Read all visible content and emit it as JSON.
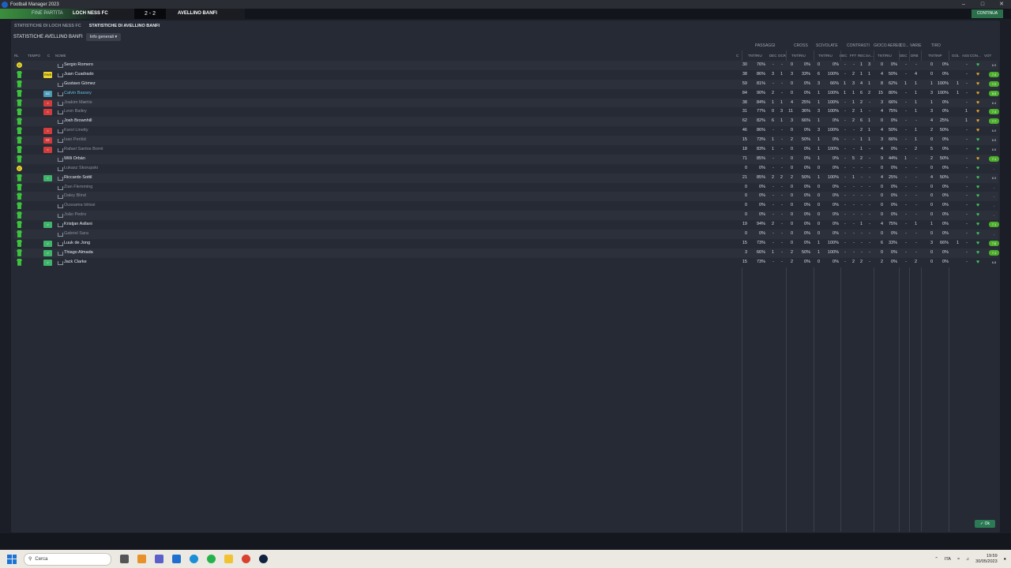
{
  "window": {
    "title": "Football Manager 2023"
  },
  "matchbar": {
    "status": "FINE PARTITA",
    "home": "LOCH NESS FC",
    "score": "2 - 2",
    "away": "AVELLINO BANFI",
    "right_label": "CONTINUA"
  },
  "tabs": [
    "STATISTICHE DI LOCH NESS FC",
    "STATISTICHE DI AVELLINO BANFI"
  ],
  "subhead": {
    "title": "STATISTICHE AVELLINO BANFI",
    "view": "Info generali"
  },
  "groups": [
    "PASSAGGI",
    "CROSS",
    "SCIVOLATE",
    "CONTRASTI",
    "GIOCO AEREO",
    "CO...",
    "VARIE",
    "TIRO"
  ],
  "columns": {
    "rl": "RL",
    "tempo": "TEMPO",
    "c": "C",
    "nome": "NOME",
    "c2": "C",
    "pass": "TNT/RIU",
    "dec": "DEC",
    "occ": "OCR",
    "cross": "TNT/RIU",
    "scivolate": "TNT/RIU",
    "contr_dec": "DEC",
    "fft": "FFT",
    "rec": "REC",
    "sa": "SA...",
    "aereo": "TNT/RIU",
    "co_dec": "DEC",
    "dri": "DRB",
    "tiro": "TNT/INP",
    "gol": "GOL",
    "ass": "ASS",
    "con": "CON...",
    "vot": "VOT"
  },
  "players": [
    {
      "name": "Sergio Romero",
      "role": "",
      "role_color": "",
      "captain": true,
      "pass_t": "30",
      "pass_p": "76%",
      "dec": "-",
      "occ": "-",
      "cr_t": "0",
      "cr_p": "0%",
      "sc_t": "0",
      "sc_p": "0%",
      "cd": "-",
      "fft": "-",
      "rec": "1",
      "sa": "3",
      "ae_t": "0",
      "ae_p": "0%",
      "co": "-",
      "drb": "-",
      "ti_t": "0",
      "ti_p": "0%",
      "gol": "",
      "ass": "-",
      "heart": "g",
      "vot": "6.9",
      "vot_good": false,
      "dim": false
    },
    {
      "name": "Juan Cuadrado",
      "role": "RWB",
      "role_color": "y",
      "captain": false,
      "pass_t": "38",
      "pass_p": "86%",
      "dec": "3",
      "occ": "1",
      "cr_t": "3",
      "cr_p": "33%",
      "sc_t": "6",
      "sc_p": "100%",
      "cd": "-",
      "fft": "2",
      "rec": "1",
      "sa": "1",
      "ae_t": "4",
      "ae_p": "50%",
      "co": "-",
      "drb": "4",
      "ti_t": "0",
      "ti_p": "0%",
      "gol": "",
      "ass": "-",
      "heart": "o",
      "vot": "7.4",
      "vot_good": true,
      "dim": false
    },
    {
      "name": "Gustavo Gómez",
      "role": "",
      "role_color": "",
      "captain": false,
      "pass_t": "59",
      "pass_p": "81%",
      "dec": "-",
      "occ": "-",
      "cr_t": "0",
      "cr_p": "0%",
      "sc_t": "3",
      "sc_p": "66%",
      "cd": "1",
      "fft": "3",
      "rec": "4",
      "sa": "1",
      "ae_t": "8",
      "ae_p": "62%",
      "co": "1",
      "drb": "1",
      "ti_t": "1",
      "ti_p": "100%",
      "gol": "1",
      "ass": "-",
      "heart": "o",
      "vot": "7.2",
      "vot_good": true,
      "dim": false
    },
    {
      "name": "Calvin Bassey",
      "role": "DC",
      "role_color": "b",
      "captain": false,
      "pass_t": "84",
      "pass_p": "90%",
      "dec": "2",
      "occ": "-",
      "cr_t": "0",
      "cr_p": "0%",
      "sc_t": "1",
      "sc_p": "100%",
      "cd": "1",
      "fft": "1",
      "rec": "6",
      "sa": "2",
      "ae_t": "15",
      "ae_p": "80%",
      "co": "-",
      "drb": "1",
      "ti_t": "3",
      "ti_p": "100%",
      "gol": "1",
      "ass": "-",
      "heart": "o",
      "vot": "8.5",
      "vot_good": true,
      "dim": false,
      "highlight": true
    },
    {
      "name": "Joakim Mæhle",
      "role": "<",
      "role_color": "r",
      "captain": false,
      "pass_t": "38",
      "pass_p": "84%",
      "dec": "1",
      "occ": "1",
      "cr_t": "4",
      "cr_p": "25%",
      "sc_t": "1",
      "sc_p": "100%",
      "cd": "-",
      "fft": "1",
      "rec": "2",
      "sa": "-",
      "ae_t": "3",
      "ae_p": "66%",
      "co": "-",
      "drb": "1",
      "ti_t": "1",
      "ti_p": "0%",
      "gol": "",
      "ass": "-",
      "heart": "o",
      "vot": "6.4",
      "vot_good": false,
      "dim": true
    },
    {
      "name": "Leon Bailey",
      "role": "<",
      "role_color": "r",
      "captain": false,
      "pass_t": "31",
      "pass_p": "77%",
      "dec": "0",
      "occ": "3",
      "cr_t": "11",
      "cr_p": "36%",
      "sc_t": "3",
      "sc_p": "100%",
      "cd": "-",
      "fft": "2",
      "rec": "1",
      "sa": "-",
      "ae_t": "4",
      "ae_p": "75%",
      "co": "-",
      "drb": "1",
      "ti_t": "3",
      "ti_p": "0%",
      "gol": "",
      "ass": "1",
      "heart": "o",
      "vot": "7.4",
      "vot_good": true,
      "dim": true
    },
    {
      "name": "Josh Brownhill",
      "role": "",
      "role_color": "",
      "captain": false,
      "pass_t": "62",
      "pass_p": "82%",
      "dec": "6",
      "occ": "1",
      "cr_t": "3",
      "cr_p": "66%",
      "sc_t": "1",
      "sc_p": "0%",
      "cd": "-",
      "fft": "2",
      "rec": "6",
      "sa": "1",
      "ae_t": "0",
      "ae_p": "0%",
      "co": "-",
      "drb": "-",
      "ti_t": "4",
      "ti_p": "25%",
      "gol": "",
      "ass": "1",
      "heart": "o",
      "vot": "7.7",
      "vot_good": true,
      "dim": false
    },
    {
      "name": "Karol Linetty",
      "role": "<",
      "role_color": "r",
      "captain": false,
      "pass_t": "46",
      "pass_p": "86%",
      "dec": "-",
      "occ": "-",
      "cr_t": "0",
      "cr_p": "0%",
      "sc_t": "3",
      "sc_p": "100%",
      "cd": "-",
      "fft": "-",
      "rec": "2",
      "sa": "1",
      "ae_t": "4",
      "ae_p": "50%",
      "co": "-",
      "drb": "1",
      "ti_t": "2",
      "ti_p": "50%",
      "gol": "",
      "ass": "-",
      "heart": "o",
      "vot": "6.9",
      "vot_good": false,
      "dim": true
    },
    {
      "name": "Ivan Perišić",
      "role": "ST",
      "role_color": "r",
      "captain": false,
      "pass_t": "15",
      "pass_p": "73%",
      "dec": "1",
      "occ": "-",
      "cr_t": "2",
      "cr_p": "50%",
      "sc_t": "1",
      "sc_p": "0%",
      "cd": "-",
      "fft": "-",
      "rec": "1",
      "sa": "1",
      "ae_t": "3",
      "ae_p": "66%",
      "co": "-",
      "drb": "1",
      "ti_t": "0",
      "ti_p": "0%",
      "gol": "",
      "ass": "-",
      "heart": "r",
      "vot": "6.5",
      "vot_good": false,
      "dim": true
    },
    {
      "name": "Rafael Santos Borré",
      "role": "<",
      "role_color": "r",
      "captain": false,
      "pass_t": "18",
      "pass_p": "83%",
      "dec": "1",
      "occ": "-",
      "cr_t": "0",
      "cr_p": "0%",
      "sc_t": "1",
      "sc_p": "100%",
      "cd": "-",
      "fft": "-",
      "rec": "1",
      "sa": "-",
      "ae_t": "4",
      "ae_p": "0%",
      "co": "-",
      "drb": "2",
      "ti_t": "5",
      "ti_p": "0%",
      "gol": "",
      "ass": "-",
      "heart": "g",
      "vot": "6.5",
      "vot_good": false,
      "dim": true
    },
    {
      "name": "Willi Orbán",
      "role": "",
      "role_color": "",
      "captain": false,
      "pass_t": "71",
      "pass_p": "85%",
      "dec": "-",
      "occ": "-",
      "cr_t": "0",
      "cr_p": "0%",
      "sc_t": "1",
      "sc_p": "0%",
      "cd": "-",
      "fft": "5",
      "rec": "2",
      "sa": "-",
      "ae_t": "9",
      "ae_p": "44%",
      "co": "1",
      "drb": "-",
      "ti_t": "2",
      "ti_p": "50%",
      "gol": "",
      "ass": "-",
      "heart": "o",
      "vot": "7.1",
      "vot_good": true,
      "dim": false
    },
    {
      "name": "Łukasz Skorupski",
      "role": "",
      "role_color": "",
      "captain": true,
      "pass_t": "0",
      "pass_p": "0%",
      "dec": "-",
      "occ": "-",
      "cr_t": "0",
      "cr_p": "0%",
      "sc_t": "0",
      "sc_p": "0%",
      "cd": "-",
      "fft": "-",
      "rec": "-",
      "sa": "-",
      "ae_t": "0",
      "ae_p": "0%",
      "co": "-",
      "drb": "-",
      "ti_t": "0",
      "ti_p": "0%",
      "gol": "",
      "ass": "-",
      "heart": "g",
      "vot": "-",
      "vot_good": false,
      "dim": true
    },
    {
      "name": "Riccardo Sottil",
      "role": ">",
      "role_color": "g",
      "captain": false,
      "pass_t": "21",
      "pass_p": "85%",
      "dec": "2",
      "occ": "2",
      "cr_t": "2",
      "cr_p": "50%",
      "sc_t": "1",
      "sc_p": "100%",
      "cd": "-",
      "fft": "1",
      "rec": "-",
      "sa": "-",
      "ae_t": "4",
      "ae_p": "25%",
      "co": "-",
      "drb": "-",
      "ti_t": "4",
      "ti_p": "50%",
      "gol": "",
      "ass": "-",
      "heart": "g",
      "vot": "6.9",
      "vot_good": false,
      "dim": false
    },
    {
      "name": "Zian Flemming",
      "role": "",
      "role_color": "",
      "captain": false,
      "pass_t": "0",
      "pass_p": "0%",
      "dec": "-",
      "occ": "-",
      "cr_t": "0",
      "cr_p": "0%",
      "sc_t": "0",
      "sc_p": "0%",
      "cd": "-",
      "fft": "-",
      "rec": "-",
      "sa": "-",
      "ae_t": "0",
      "ae_p": "0%",
      "co": "-",
      "drb": "-",
      "ti_t": "0",
      "ti_p": "0%",
      "gol": "",
      "ass": "-",
      "heart": "g",
      "vot": "-",
      "vot_good": false,
      "dim": true
    },
    {
      "name": "Daley Blind",
      "role": "",
      "role_color": "",
      "captain": false,
      "pass_t": "0",
      "pass_p": "0%",
      "dec": "-",
      "occ": "-",
      "cr_t": "0",
      "cr_p": "0%",
      "sc_t": "0",
      "sc_p": "0%",
      "cd": "-",
      "fft": "-",
      "rec": "-",
      "sa": "-",
      "ae_t": "0",
      "ae_p": "0%",
      "co": "-",
      "drb": "-",
      "ti_t": "0",
      "ti_p": "0%",
      "gol": "",
      "ass": "-",
      "heart": "g",
      "vot": "-",
      "vot_good": false,
      "dim": true
    },
    {
      "name": "Oussama Idrissi",
      "role": "",
      "role_color": "",
      "captain": false,
      "pass_t": "0",
      "pass_p": "0%",
      "dec": "-",
      "occ": "-",
      "cr_t": "0",
      "cr_p": "0%",
      "sc_t": "0",
      "sc_p": "0%",
      "cd": "-",
      "fft": "-",
      "rec": "-",
      "sa": "-",
      "ae_t": "0",
      "ae_p": "0%",
      "co": "-",
      "drb": "-",
      "ti_t": "0",
      "ti_p": "0%",
      "gol": "",
      "ass": "-",
      "heart": "g",
      "vot": "-",
      "vot_good": false,
      "dim": true
    },
    {
      "name": "João Pedro",
      "role": "",
      "role_color": "",
      "captain": false,
      "pass_t": "0",
      "pass_p": "0%",
      "dec": "-",
      "occ": "-",
      "cr_t": "0",
      "cr_p": "0%",
      "sc_t": "0",
      "sc_p": "0%",
      "cd": "-",
      "fft": "-",
      "rec": "-",
      "sa": "-",
      "ae_t": "0",
      "ae_p": "0%",
      "co": "-",
      "drb": "-",
      "ti_t": "0",
      "ti_p": "0%",
      "gol": "",
      "ass": "-",
      "heart": "g",
      "vot": "-",
      "vot_good": false,
      "dim": true
    },
    {
      "name": "Kristjan Asllani",
      "role": ">",
      "role_color": "g",
      "captain": false,
      "pass_t": "19",
      "pass_p": "94%",
      "dec": "2",
      "occ": "-",
      "cr_t": "0",
      "cr_p": "0%",
      "sc_t": "0",
      "sc_p": "0%",
      "cd": "-",
      "fft": "-",
      "rec": "1",
      "sa": "-",
      "ae_t": "4",
      "ae_p": "75%",
      "co": "-",
      "drb": "1",
      "ti_t": "1",
      "ti_p": "0%",
      "gol": "",
      "ass": "-",
      "heart": "g",
      "vot": "7.1",
      "vot_good": true,
      "dim": false
    },
    {
      "name": "Gabriel Sara",
      "role": "",
      "role_color": "",
      "captain": false,
      "pass_t": "0",
      "pass_p": "0%",
      "dec": "-",
      "occ": "-",
      "cr_t": "0",
      "cr_p": "0%",
      "sc_t": "0",
      "sc_p": "0%",
      "cd": "-",
      "fft": "-",
      "rec": "-",
      "sa": "-",
      "ae_t": "0",
      "ae_p": "0%",
      "co": "-",
      "drb": "-",
      "ti_t": "0",
      "ti_p": "0%",
      "gol": "",
      "ass": "-",
      "heart": "g",
      "vot": "-",
      "vot_good": false,
      "dim": true
    },
    {
      "name": "Luuk de Jong",
      "role": ">",
      "role_color": "g",
      "captain": false,
      "pass_t": "15",
      "pass_p": "73%",
      "dec": "-",
      "occ": "-",
      "cr_t": "0",
      "cr_p": "0%",
      "sc_t": "1",
      "sc_p": "100%",
      "cd": "-",
      "fft": "-",
      "rec": "-",
      "sa": "-",
      "ae_t": "6",
      "ae_p": "33%",
      "co": "-",
      "drb": "-",
      "ti_t": "3",
      "ti_p": "66%",
      "gol": "1",
      "ass": "-",
      "heart": "g",
      "vot": "7.6",
      "vot_good": true,
      "dim": false
    },
    {
      "name": "Thiago Almada",
      "role": ">",
      "role_color": "g",
      "captain": false,
      "pass_t": "3",
      "pass_p": "66%",
      "dec": "1",
      "occ": "-",
      "cr_t": "2",
      "cr_p": "50%",
      "sc_t": "1",
      "sc_p": "100%",
      "cd": "-",
      "fft": "-",
      "rec": "-",
      "sa": "-",
      "ae_t": "0",
      "ae_p": "0%",
      "co": "-",
      "drb": "-",
      "ti_t": "0",
      "ti_p": "0%",
      "gol": "",
      "ass": "-",
      "heart": "g",
      "vot": "7.1",
      "vot_good": true,
      "dim": false
    },
    {
      "name": "Jack Clarke",
      "role": ">",
      "role_color": "g",
      "captain": false,
      "pass_t": "15",
      "pass_p": "73%",
      "dec": "-",
      "occ": "-",
      "cr_t": "2",
      "cr_p": "0%",
      "sc_t": "0",
      "sc_p": "0%",
      "cd": "-",
      "fft": "2",
      "rec": "2",
      "sa": "-",
      "ae_t": "2",
      "ae_p": "0%",
      "co": "-",
      "drb": "2",
      "ti_t": "0",
      "ti_p": "0%",
      "gol": "",
      "ass": "-",
      "heart": "g",
      "vot": "6.8",
      "vot_good": false,
      "dim": false
    }
  ],
  "ok_button": "Ok",
  "taskbar": {
    "search_placeholder": "Cerca",
    "lang": "ITA",
    "time": "19:59",
    "date": "30/05/2023"
  }
}
